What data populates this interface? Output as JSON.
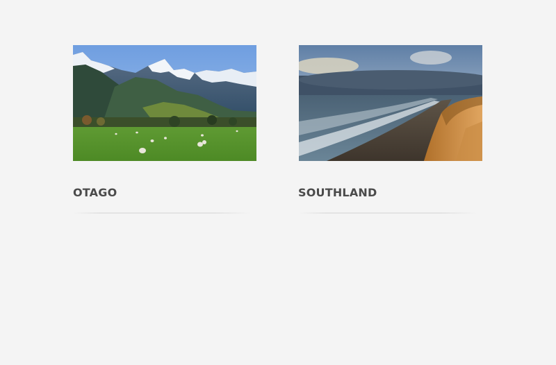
{
  "regions": [
    {
      "name": "OTAGO",
      "image": "mountain-pasture-sheep-photo"
    },
    {
      "name": "SOUTHLAND",
      "image": "coastal-beach-cliffs-photo"
    }
  ],
  "colors": {
    "background": "#f4f4f4",
    "title_text": "#4a4a4a",
    "divider": "#e3e3e3"
  }
}
